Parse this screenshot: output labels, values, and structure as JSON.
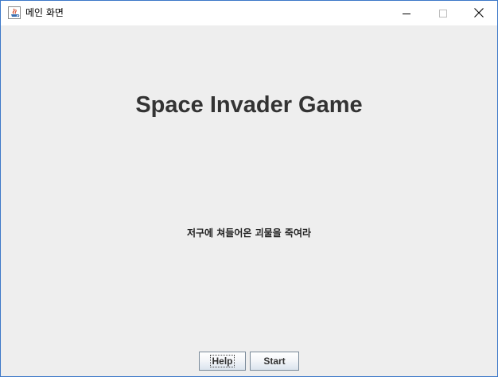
{
  "window": {
    "title": "메인 화면",
    "app_icon": "java-icon",
    "controls": {
      "minimize_icon": "minimize-icon",
      "maximize_icon": "maximize-icon",
      "close_icon": "close-icon"
    }
  },
  "main": {
    "title": "Space Invader Game",
    "subtitle": "저구에 쳐들어온 괴물을 죽여라"
  },
  "buttons": {
    "help_label": "Help",
    "start_label": "Start"
  },
  "colors": {
    "window_border": "#3c78c8",
    "content_background": "#eeeeee",
    "title_text": "#333333"
  }
}
